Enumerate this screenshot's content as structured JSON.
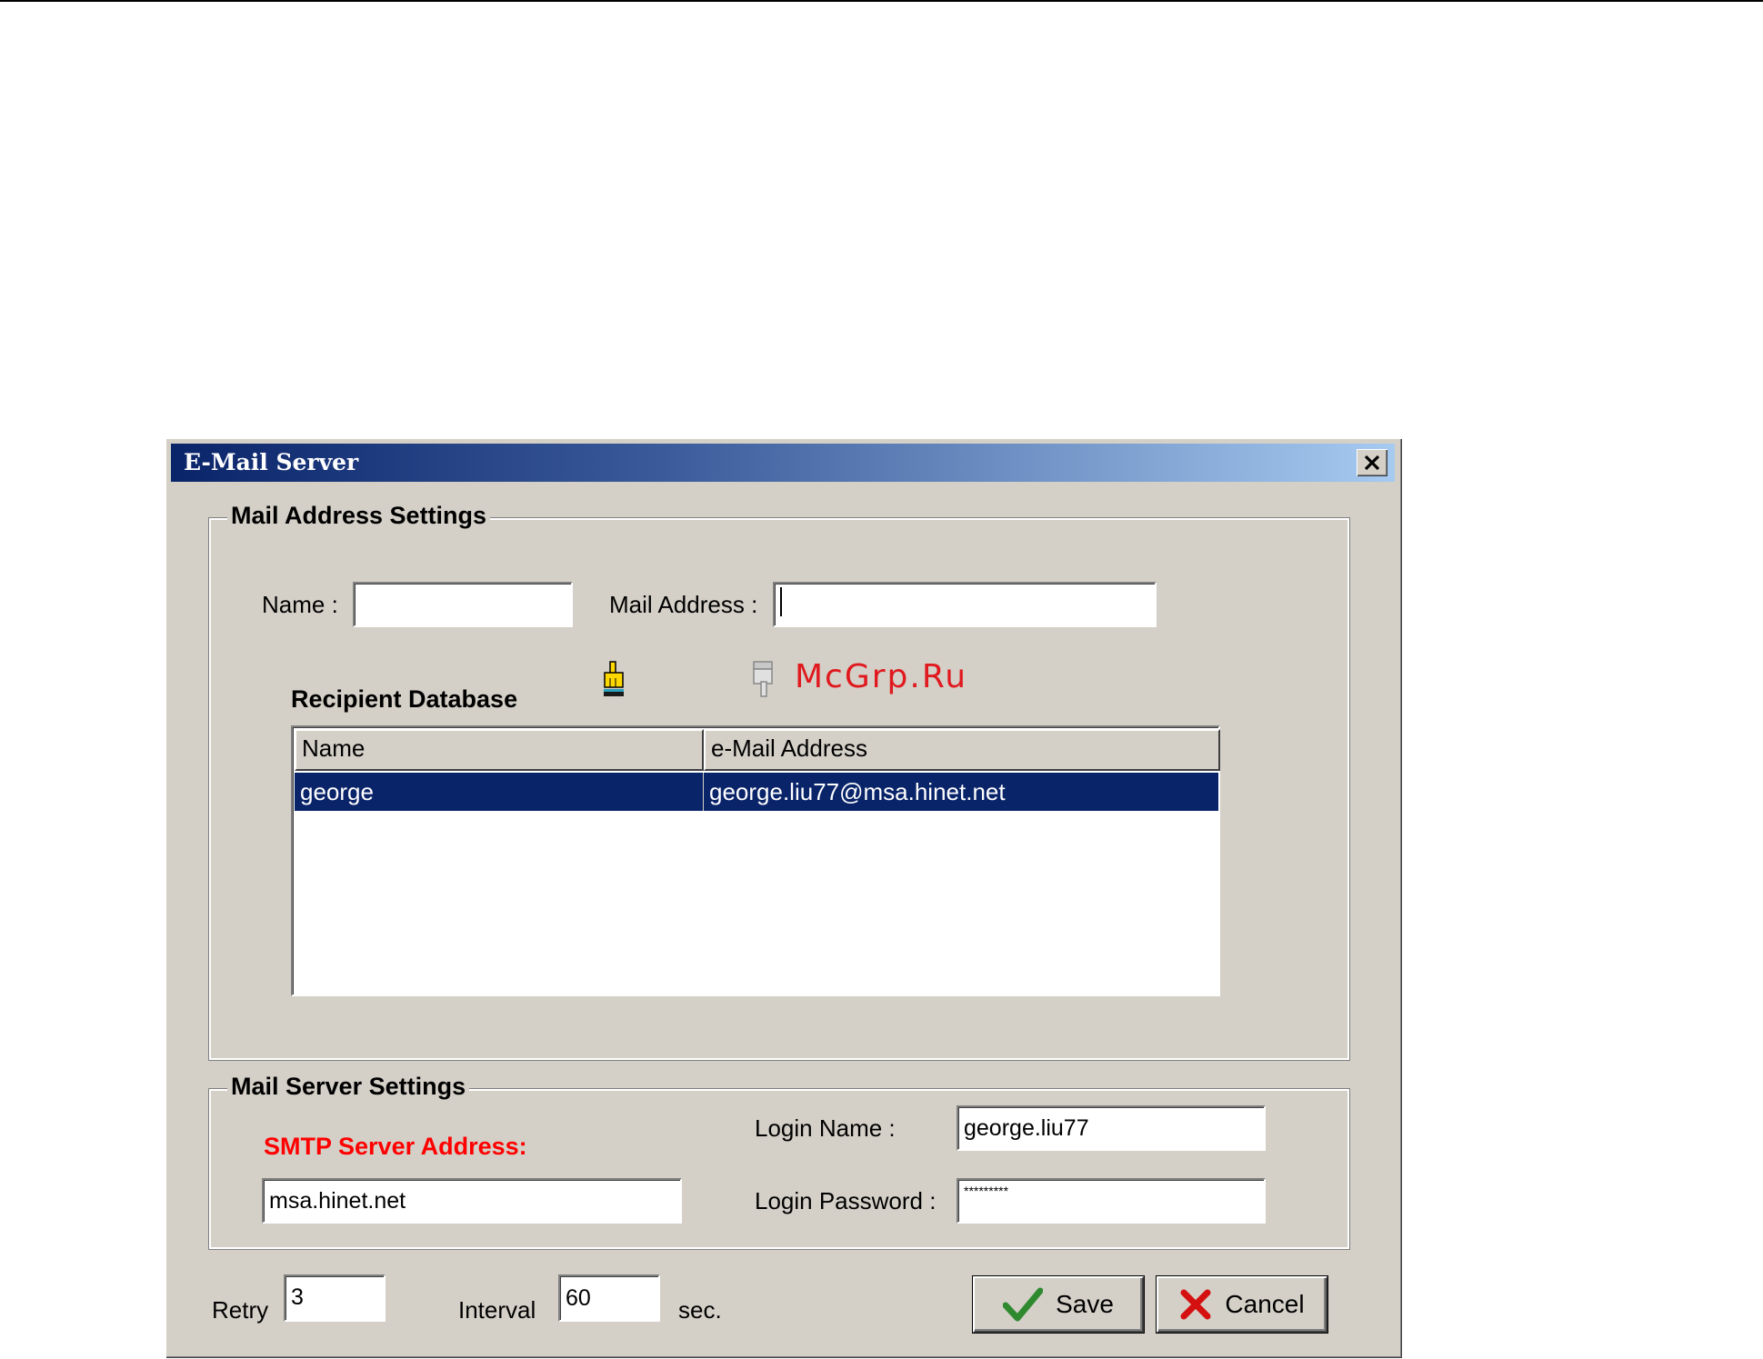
{
  "window": {
    "title": "E-Mail Server"
  },
  "mail_address_settings": {
    "group_title": "Mail Address Settings",
    "name_label": "Name :",
    "name_value": "",
    "mail_label": "Mail Address :",
    "mail_value": ""
  },
  "recipient_db": {
    "title": "Recipient Database",
    "columns": [
      "Name",
      "e-Mail Address"
    ],
    "rows": [
      {
        "name": "george",
        "email": "george.liu77@msa.hinet.net"
      }
    ]
  },
  "mail_server_settings": {
    "group_title": "Mail Server Settings",
    "smtp_label": "SMTP Server Address:",
    "smtp_value": "msa.hinet.net",
    "login_name_label": "Login Name :",
    "login_name_value": "george.liu77",
    "login_password_label": "Login Password :",
    "login_password_value": "*********"
  },
  "bottom": {
    "retry_label": "Retry",
    "retry_value": "3",
    "interval_label": "Interval",
    "interval_value": "60",
    "sec_label": "sec."
  },
  "buttons": {
    "save": "Save",
    "cancel": "Cancel"
  },
  "watermark": "McGrp.Ru",
  "colors": {
    "selection": "#0a246a",
    "required_label": "#ff0000"
  }
}
